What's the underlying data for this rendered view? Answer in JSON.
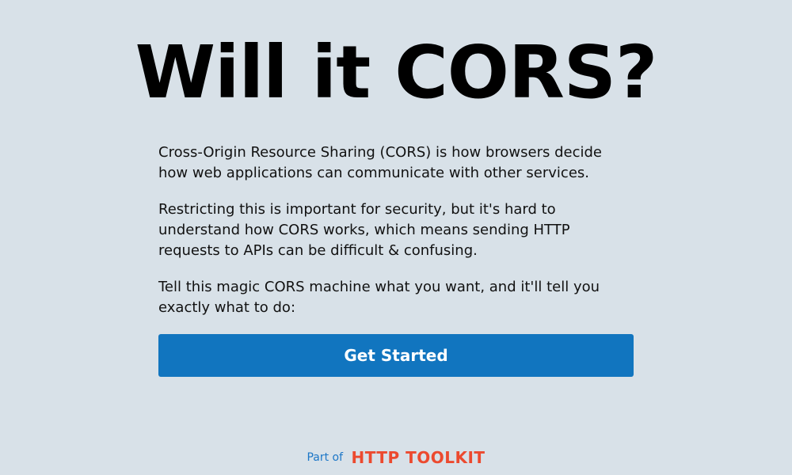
{
  "header": {
    "title": "Will it CORS?"
  },
  "main": {
    "paragraphs": [
      "Cross-Origin Resource Sharing (CORS) is how browsers decide how web applications can communicate with other services.",
      "Restricting this is important for security, but it's hard to understand how CORS works, which means sending HTTP requests to APIs can be difficult & confusing.",
      "Tell this magic CORS machine what you want, and it'll tell you exactly what to do:"
    ],
    "cta_label": "Get Started"
  },
  "footer": {
    "part_of": "Part of",
    "brand": "HTTP TOOLKIT"
  },
  "colors": {
    "background": "#d8e1e8",
    "button": "#1175bf",
    "brand": "#ec4a2f",
    "link": "#1d77c7"
  }
}
